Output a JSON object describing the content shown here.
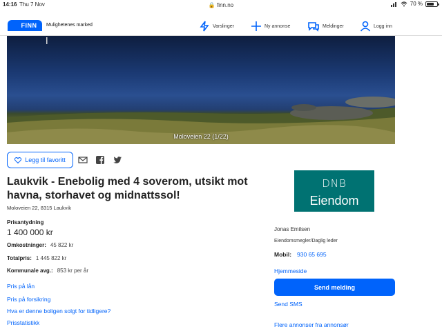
{
  "status_bar": {
    "time": "14:16",
    "date": "Thu 7 Nov",
    "url": "finn.no",
    "battery": "70 %",
    "battery_level": 0.7
  },
  "header": {
    "logo_text": "FINN",
    "tagline": "Mulighetenes marked",
    "nav": [
      {
        "label": "Varslinger",
        "icon": "bolt-icon"
      },
      {
        "label": "Ny annonse",
        "icon": "plus-icon"
      },
      {
        "label": "Meldinger",
        "icon": "chat-icon"
      },
      {
        "label": "Logg inn",
        "icon": "user-icon"
      }
    ],
    "accent_color": "#0063fb"
  },
  "hero": {
    "caption": "Moloveien 22 (1/22)"
  },
  "actions": {
    "favorite_label": "Legg til favoritt"
  },
  "listing": {
    "title": "Laukvik - Enebolig med 4 soverom, utsikt mot havna, storhavet og midnattssol!",
    "address": "Moloveien 22, 8315 Laukvik",
    "price_label": "Prisantydning",
    "price": "1 400 000 kr",
    "costs": [
      {
        "label": "Omkostninger:",
        "value": "45 822 kr"
      },
      {
        "label": "Totalpris:",
        "value": "1 445 822 kr"
      },
      {
        "label": "Kommunale avg.:",
        "value": "853 kr per år"
      }
    ],
    "links": [
      "Pris på lån",
      "Pris på forsikring",
      "Hva er denne boligen solgt for tidligere?",
      "Prisstatistikk"
    ]
  },
  "agent": {
    "brand_line1": "DNB",
    "brand_line2": "Eiendom",
    "brand_color": "#007272",
    "name": "Jonas Emilsen",
    "role": "Eiendomsmegler/Daglig leder",
    "mobile_label": "Mobil:",
    "mobile_value": "930 65 695",
    "homepage_link": "Hjemmeside",
    "send_message": "Send melding",
    "send_sms": "Send SMS",
    "more_ads": "Flere annonser fra annonsør"
  }
}
